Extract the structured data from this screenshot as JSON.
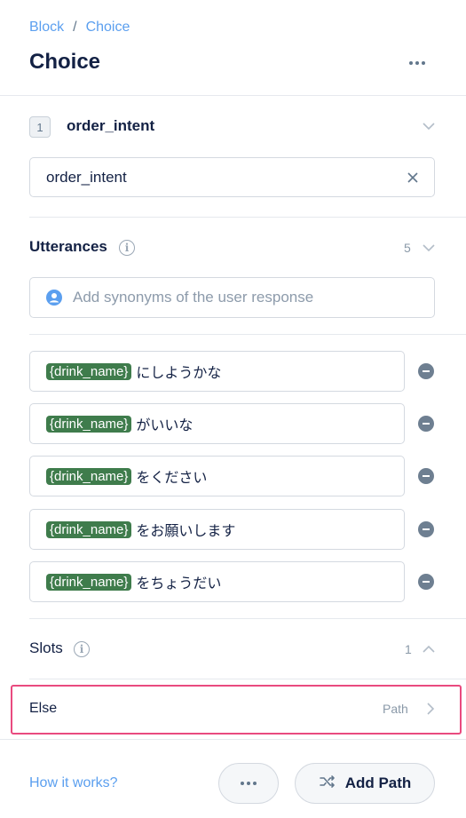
{
  "breadcrumb": {
    "parent": "Block",
    "separator": "/",
    "current": "Choice"
  },
  "title": "Choice",
  "intent": {
    "index": "1",
    "label": "order_intent",
    "input_value": "order_intent"
  },
  "utterances": {
    "label": "Utterances",
    "count": "5",
    "synonym_placeholder": "Add synonyms of the user response",
    "items": [
      {
        "slot": "{drink_name}",
        "text": "にしようかな"
      },
      {
        "slot": "{drink_name}",
        "text": "がいいな"
      },
      {
        "slot": "{drink_name}",
        "text": "をください"
      },
      {
        "slot": "{drink_name}",
        "text": "をお願いします"
      },
      {
        "slot": "{drink_name}",
        "text": "をちょうだい"
      }
    ]
  },
  "slots": {
    "label": "Slots",
    "count": "1"
  },
  "else": {
    "label": "Else",
    "path_label": "Path"
  },
  "footer": {
    "how_it_works": "How it works?",
    "add_path": "Add Path"
  },
  "colors": {
    "accent": "#5b9fef",
    "slot_chip": "#3f7c4c",
    "highlight": "#e94a7f"
  }
}
